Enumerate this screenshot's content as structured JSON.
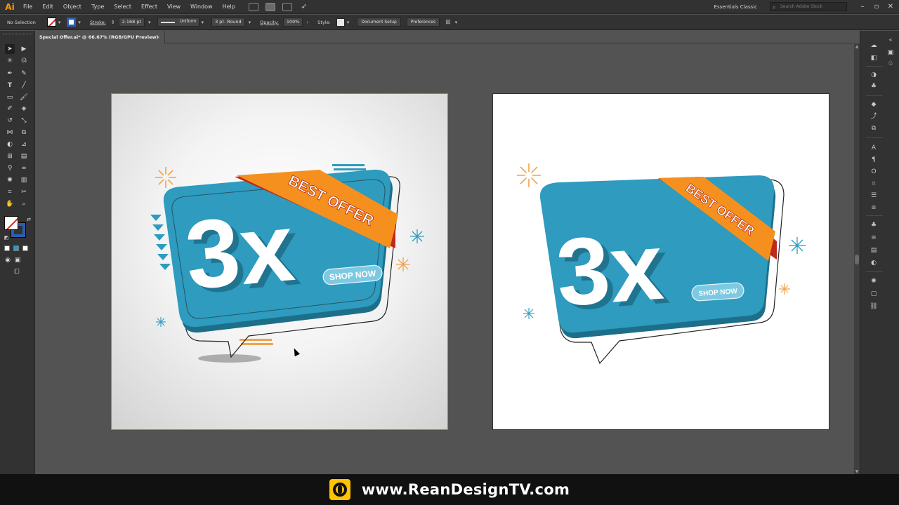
{
  "app": {
    "logo": "Ai",
    "document_tab": "Special Offer.ai* @ 66.67% (RGB/GPU Preview)",
    "tab_close": "×"
  },
  "menu": {
    "items": [
      "File",
      "Edit",
      "Object",
      "Type",
      "Select",
      "Effect",
      "View",
      "Window",
      "Help"
    ],
    "workspace": "Essentials Classic",
    "stock_search_placeholder": "Search Adobe Stock"
  },
  "control_bar": {
    "selection": "No Selection",
    "stroke_label": "Stroke:",
    "stroke_weight": "2.168 pt",
    "stroke_profile": "Uniform",
    "brush": "3 pt. Round",
    "opacity_label": "Opacity:",
    "opacity_value": "100%",
    "style_label": "Style:",
    "document_setup": "Document Setup",
    "preferences": "Preferences"
  },
  "artwork": {
    "headline": "3x",
    "ribbon": "BEST OFFER",
    "button": "SHOP NOW"
  },
  "colors": {
    "brand_blue": "#2e9bbf",
    "ribbon_orange": "#f5901e",
    "ribbon_dark": "#c0281e",
    "accent_tan": "#f1a24a",
    "chrome_dark": "#323232",
    "canvas_bg": "#535353"
  },
  "icons": {
    "tools": [
      "selection-tool-icon",
      "direct-selection-tool-icon",
      "magic-wand-tool-icon",
      "lasso-tool-icon",
      "pen-tool-icon",
      "curvature-tool-icon",
      "type-tool-icon",
      "line-tool-icon",
      "rectangle-tool-icon",
      "paintbrush-tool-icon",
      "shaper-tool-icon",
      "eraser-tool-icon",
      "rotate-tool-icon",
      "scale-tool-icon",
      "width-tool-icon",
      "free-transform-tool-icon",
      "shape-builder-tool-icon",
      "perspective-grid-tool-icon",
      "mesh-tool-icon",
      "gradient-tool-icon",
      "eyedropper-tool-icon",
      "blend-tool-icon",
      "symbol-sprayer-tool-icon",
      "column-graph-tool-icon",
      "artboard-tool-icon",
      "slice-tool-icon",
      "hand-tool-icon",
      "zoom-tool-icon"
    ],
    "panels": [
      "libraries-icon",
      "properties-icon",
      "color-icon",
      "color-guide-icon",
      "swatches-icon",
      "layers-icon",
      "asset-export-icon",
      "artboards-icon",
      "character-icon",
      "paragraph-icon",
      "opentype-icon",
      "transform-icon",
      "align-icon",
      "pathfinder-icon",
      "stroke-icon",
      "gradient-icon",
      "transparency-icon",
      "appearance-icon",
      "graphic-styles-icon",
      "links-icon"
    ]
  },
  "brand": {
    "url": "www.ReanDesignTV.com"
  }
}
